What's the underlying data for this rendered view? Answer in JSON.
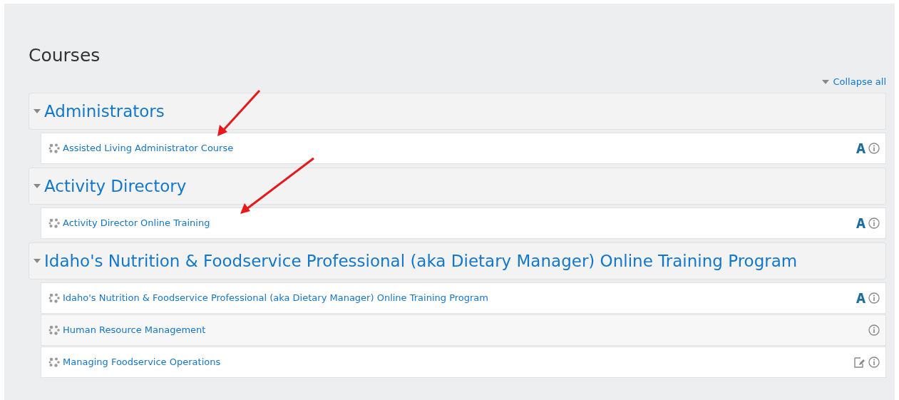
{
  "heading": "Courses",
  "collapse_all": {
    "label": "Collapse all",
    "expanded": true
  },
  "categories": [
    {
      "name": "Administrators",
      "expanded": true,
      "courses": [
        {
          "name": "Assisted Living Administrator Course",
          "icons": [
            {
              "kind": "enrol"
            },
            {
              "kind": "info"
            }
          ]
        }
      ]
    },
    {
      "name": "Activity Directory",
      "expanded": true,
      "courses": [
        {
          "name": "Activity Director Online Training",
          "icons": [
            {
              "kind": "enrol"
            },
            {
              "kind": "info"
            }
          ]
        }
      ]
    },
    {
      "name": "Idaho's Nutrition & Foodservice Professional (aka Dietary Manager) Online Training Program",
      "expanded": true,
      "courses": [
        {
          "name": "Idaho's Nutrition & Foodservice Professional (aka Dietary Manager) Online Training Program",
          "icons": [
            {
              "kind": "enrol"
            },
            {
              "kind": "info"
            }
          ]
        },
        {
          "name": "Human Resource Management",
          "icons": [
            {
              "kind": "info"
            }
          ]
        },
        {
          "name": "Managing Foodservice Operations",
          "icons": [
            {
              "kind": "edit"
            },
            {
              "kind": "info"
            }
          ]
        }
      ]
    }
  ]
}
